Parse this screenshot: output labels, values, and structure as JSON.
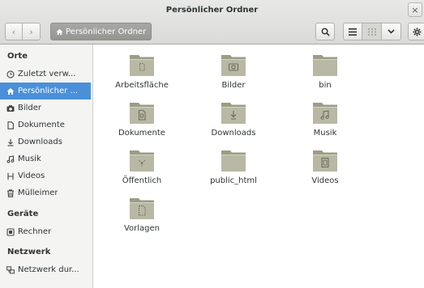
{
  "window": {
    "title": "Persönlicher Ordner",
    "close_glyph": "×"
  },
  "toolbar": {
    "back_glyph": "‹",
    "forward_glyph": "›",
    "path_button": "Persönlicher Ordner"
  },
  "sidebar": {
    "sections": [
      {
        "heading": "Orte",
        "items": [
          {
            "label": "Zuletzt verw...",
            "icon": "clock-icon",
            "selected": false
          },
          {
            "label": "Persönlicher ...",
            "icon": "home-icon",
            "selected": true
          },
          {
            "label": "Bilder",
            "icon": "camera-icon",
            "selected": false
          },
          {
            "label": "Dokumente",
            "icon": "document-icon",
            "selected": false
          },
          {
            "label": "Downloads",
            "icon": "download-icon",
            "selected": false
          },
          {
            "label": "Musik",
            "icon": "music-icon",
            "selected": false
          },
          {
            "label": "Videos",
            "icon": "video-icon",
            "selected": false
          },
          {
            "label": "Mülleimer",
            "icon": "trash-icon",
            "selected": false
          }
        ]
      },
      {
        "heading": "Geräte",
        "items": [
          {
            "label": "Rechner",
            "icon": "computer-icon",
            "selected": false
          }
        ]
      },
      {
        "heading": "Netzwerk",
        "items": [
          {
            "label": "Netzwerk dur...",
            "icon": "network-icon",
            "selected": false
          }
        ]
      }
    ]
  },
  "folders": [
    {
      "name": "Arbeitsfläche",
      "emblem": "desktop"
    },
    {
      "name": "Bilder",
      "emblem": "camera"
    },
    {
      "name": "bin",
      "emblem": "none"
    },
    {
      "name": "Dokumente",
      "emblem": "document"
    },
    {
      "name": "Downloads",
      "emblem": "download"
    },
    {
      "name": "Musik",
      "emblem": "music"
    },
    {
      "name": "Öffentlich",
      "emblem": "share"
    },
    {
      "name": "public_html",
      "emblem": "none"
    },
    {
      "name": "Videos",
      "emblem": "video"
    },
    {
      "name": "Vorlagen",
      "emblem": "template"
    }
  ],
  "colors": {
    "selection": "#4a90d9",
    "folder_body": "#b8b8a4",
    "folder_tab": "#9c9c86",
    "folder_emblem": "#6e6e5c"
  }
}
